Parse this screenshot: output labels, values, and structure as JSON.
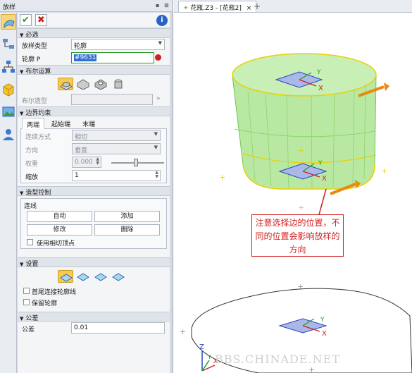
{
  "panel": {
    "title": "放样",
    "pin_icon": "pin-icon",
    "close_icon": "close-icon",
    "side_tools": [
      "loft-tool-icon",
      "hierarchy-icon",
      "tree-icon",
      "cube-icon",
      "image-icon",
      "user-icon"
    ]
  },
  "toolbar": {
    "ok_label": "✔",
    "cancel_label": "✖",
    "info_label": "i"
  },
  "required": {
    "header": "必选",
    "loft_type_label": "放样类型",
    "loft_type_value": "轮廓",
    "profile_label": "轮廓 P",
    "profile_value": "#9631"
  },
  "boolean": {
    "header": "布尔运算",
    "shape_label": "布尔造型"
  },
  "boundary": {
    "header": "边界约束",
    "tabs": [
      "两端",
      "起始端",
      "末端"
    ],
    "connect_label": "连续方式",
    "connect_value": "相切",
    "direction_label": "方向",
    "direction_value": "垂直",
    "weight_label": "权重",
    "weight_value": "0.000",
    "scale_label": "缩放",
    "scale_value": "1"
  },
  "shape_control": {
    "header": "造型控制",
    "group_label": "连线",
    "buttons": [
      "自动",
      "添加",
      "修改",
      "删除"
    ],
    "tangent_vertex_label": "使用相切顶点"
  },
  "settings": {
    "header": "设置",
    "connect_curve_label": "首尾连接轮廓线",
    "keep_profile_label": "保留轮廓"
  },
  "tolerance": {
    "header": "公差",
    "label": "公差",
    "value": "0.01"
  },
  "document": {
    "tab_label": "花瓶.Z3 - [花瓶2]",
    "close": "×",
    "new_tab": "+"
  },
  "viewport": {
    "note": "注意选择边的位置，不同的位置会影响放样的方向",
    "watermark": "BBS.CHINADE.NET",
    "axis_labels": {
      "x": "X",
      "y": "Y",
      "z": "Z"
    },
    "accent": "#d02020"
  }
}
